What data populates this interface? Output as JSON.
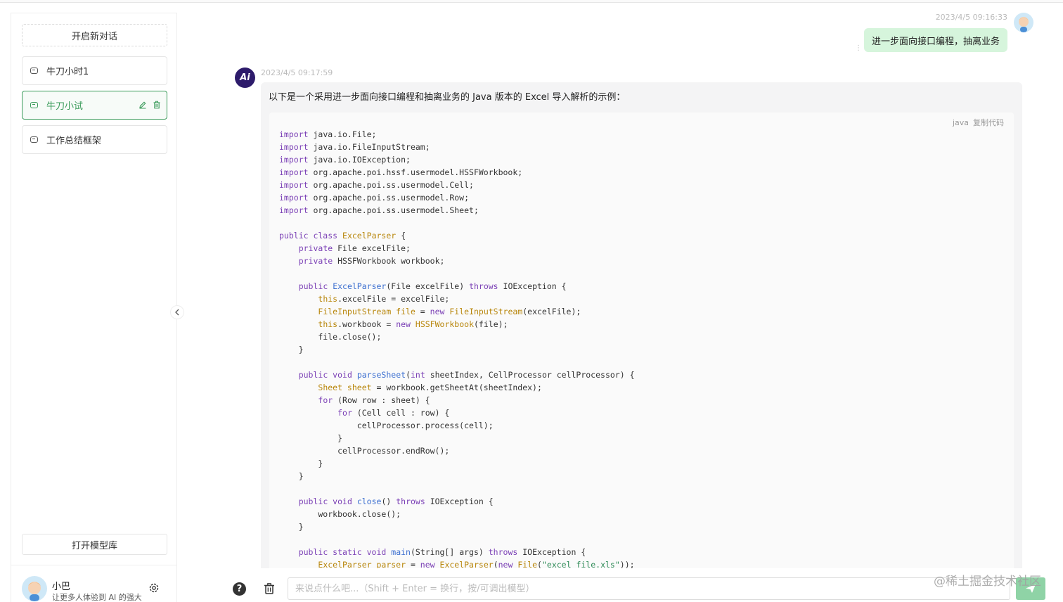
{
  "sidebar": {
    "new_chat_label": "开启新对话",
    "conversations": [
      {
        "label": "牛刀小时1"
      },
      {
        "label": "牛刀小试"
      },
      {
        "label": "工作总结框架"
      }
    ],
    "open_library_label": "打开模型库",
    "user": {
      "name": "小巴",
      "description": "让更多人体验到 AI 的强大"
    }
  },
  "chat": {
    "user_message": {
      "time": "2023/4/5 09:16:33",
      "text": "进一步面向接口编程，抽离业务"
    },
    "ai_message": {
      "avatar_text": "Ai",
      "time": "2023/4/5 09:17:59",
      "intro": "以下是一个采用进一步面向接口编程和抽离业务的 Java 版本的 Excel 导入解析的示例：",
      "code_language": "java",
      "copy_label": "复制代码"
    }
  },
  "input": {
    "placeholder": "来说点什么吧...（Shift + Enter = 换行，按/可调出模型）"
  },
  "watermark": "@稀土掘金技术社区",
  "colors": {
    "accent": "#3a9b5a",
    "user_bubble": "#d6f5dc",
    "send_button": "#8fd3a6"
  }
}
